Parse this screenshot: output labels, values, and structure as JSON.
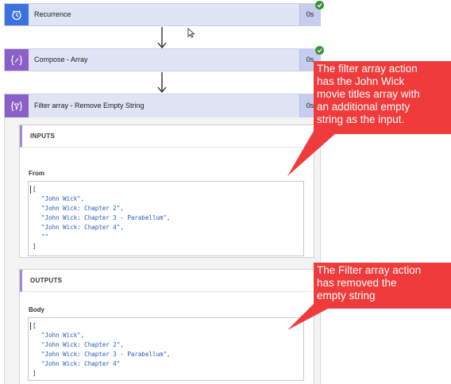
{
  "actions": [
    {
      "title": "Recurrence",
      "duration": "0s",
      "icon": "alarm-clock-icon",
      "icon_color": "#3a72e0"
    },
    {
      "title": "Compose - Array",
      "duration": "0s",
      "icon": "compose-braces-icon",
      "icon_color": "#8a5fc7"
    },
    {
      "title": "Filter array - Remove Empty String",
      "duration": "0s",
      "icon": "filter-braces-icon",
      "icon_color": "#8a5fc7"
    }
  ],
  "inputs": {
    "header": "INPUTS",
    "field_label": "From",
    "lines": [
      "[",
      "\"John Wick\",",
      "\"John Wick: Chapter 2\",",
      "\"John Wick: Chapter 3 - Parabellum\",",
      "\"John Wick: Chapter 4\",",
      "\"\"",
      "]"
    ]
  },
  "outputs": {
    "header": "OUTPUTS",
    "field_label": "Body",
    "lines": [
      "[",
      "\"John Wick\",",
      "\"John Wick: Chapter 2\",",
      "\"John Wick: Chapter 3 - Parabellum\",",
      "\"John Wick: Chapter 4\"",
      "]"
    ]
  },
  "callouts": [
    {
      "lines": [
        "The filter array action",
        "has the John Wick",
        "movie titles array with",
        "an additional empty",
        "string as the input."
      ]
    },
    {
      "lines": [
        "The Filter array action",
        "has removed the",
        "empty string"
      ]
    }
  ],
  "colors": {
    "accent": "#a08ad6",
    "action_bg": "#e1e4f5",
    "callout": "#ef3b3b",
    "success": "#3a8f3a",
    "string": "#2458b8"
  }
}
